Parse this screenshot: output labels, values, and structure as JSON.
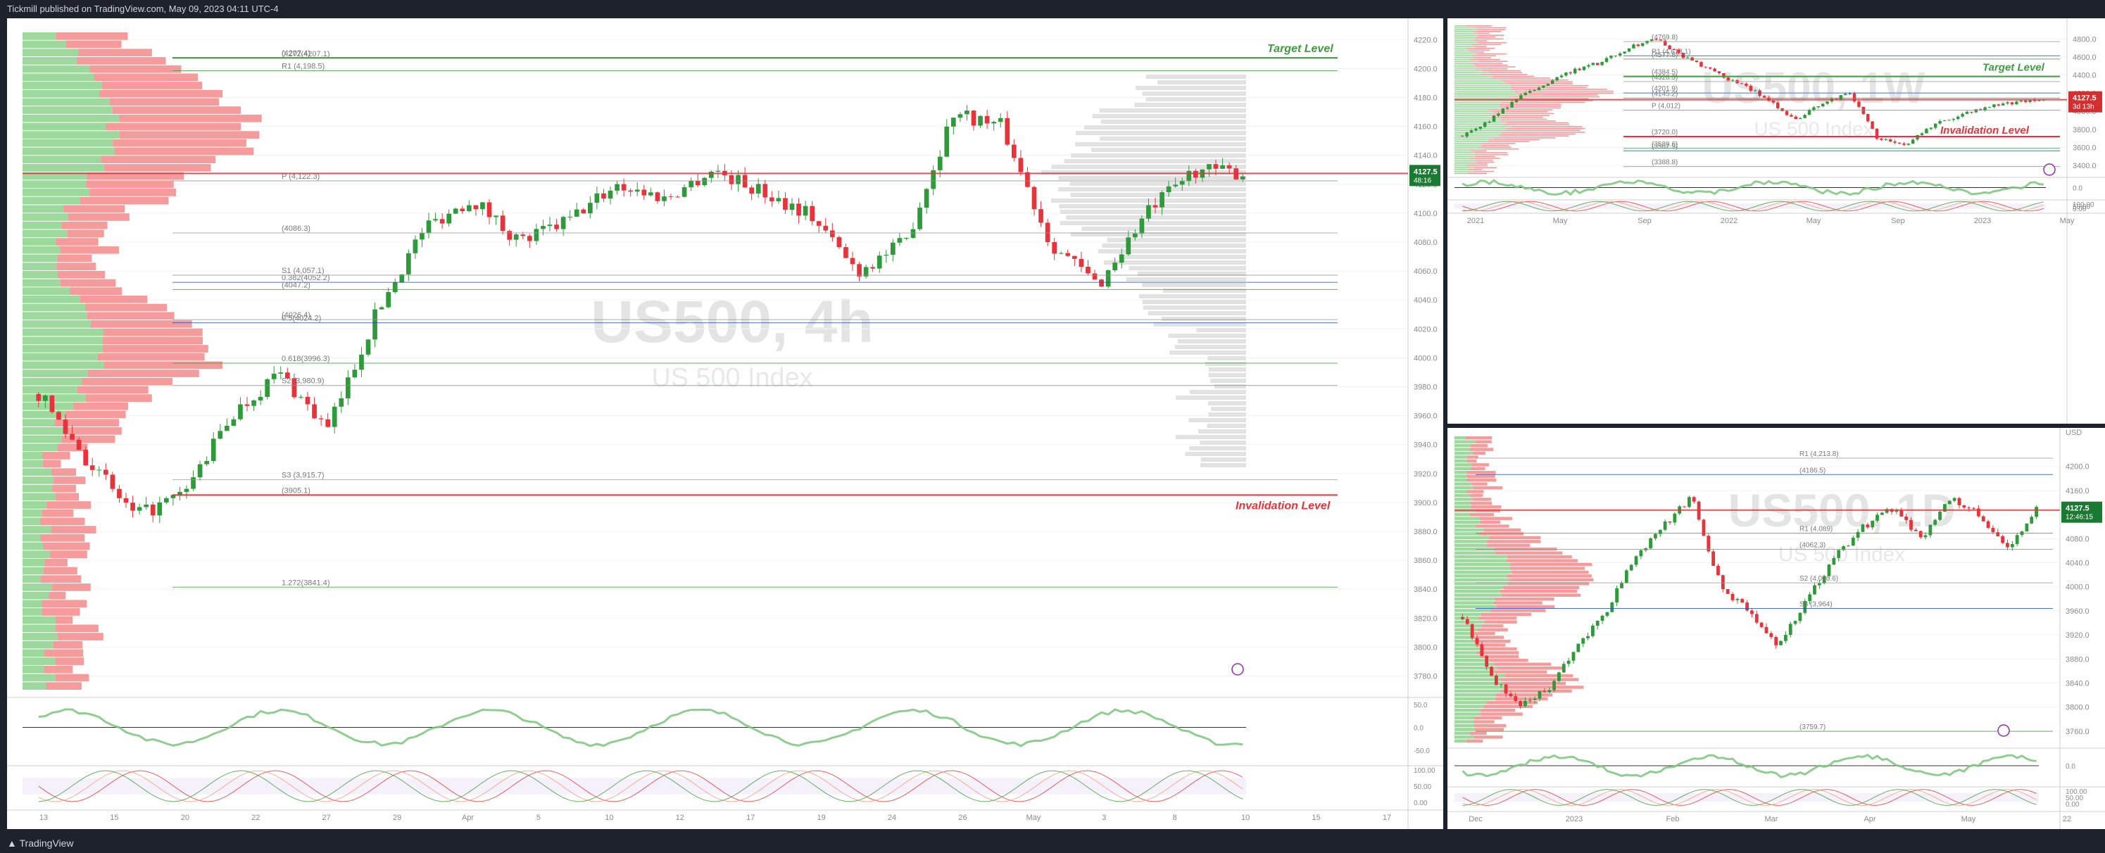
{
  "header": {
    "publisher": "Tickmill published on TradingView.com, May 09, 2023 04:11 UTC-4"
  },
  "footer": {
    "brand": "TradingView"
  },
  "colors": {
    "up": "#2e9a3a",
    "down": "#e8333a",
    "target": "#3f9b3f",
    "invalid": "#e8333a",
    "volume_green": "#7ccc7c",
    "volume_red": "#f27a7a"
  },
  "chart_data": [
    {
      "type": "candlestick",
      "title": "US500, 4h",
      "subtitle": "US 500 Index",
      "ylim": [
        3770,
        4225
      ],
      "y_ticks": [
        "4220.0",
        "4200.0",
        "4180.0",
        "4160.0",
        "4140.0",
        "4120.0",
        "4100.0",
        "4080.0",
        "4060.0",
        "4040.0",
        "4020.0",
        "4000.0",
        "3980.0",
        "3960.0",
        "3940.0",
        "3920.0",
        "3900.0",
        "3880.0",
        "3860.0",
        "3840.0",
        "3820.0",
        "3800.0",
        "3780.0"
      ],
      "x_ticks": [
        "13",
        "15",
        "20",
        "22",
        "27",
        "29",
        "Apr",
        "5",
        "10",
        "12",
        "17",
        "19",
        "24",
        "26",
        "May",
        "3",
        "8",
        "10",
        "15",
        "17"
      ],
      "last_price": "4127.5",
      "countdown": "48:16",
      "target_label": "Target Level",
      "invalidation_label": "Invalidation Level",
      "levels": [
        {
          "label": "(4207.4)",
          "value": 4207.4
        },
        {
          "label": "0.272(4207.1)",
          "value": 4207.1
        },
        {
          "label": "R1 (4,198.5)",
          "value": 4198.5
        },
        {
          "label": "P (4,122.3)",
          "value": 4122.3
        },
        {
          "label": "(4086.3)",
          "value": 4086.3
        },
        {
          "label": "0.382(4052.2)",
          "value": 4052.2
        },
        {
          "label": "(4047.2)",
          "value": 4047.2
        },
        {
          "label": "S1 (4,057.1)",
          "value": 4057.1
        },
        {
          "label": "(4026.4)",
          "value": 4026.4
        },
        {
          "label": "0.5(4024.2)",
          "value": 4024.2
        },
        {
          "label": "0.618(3996.3)",
          "value": 3996.3
        },
        {
          "label": "S2 (3,980.9)",
          "value": 3980.9
        },
        {
          "label": "S3 (3,915.7)",
          "value": 3915.7
        },
        {
          "label": "(3905.1)",
          "value": 3905.1
        },
        {
          "label": "1.272(3841.4)",
          "value": 3841.4
        }
      ],
      "oscillator_ticks": [
        "50.0",
        "0.0",
        "-50.0"
      ],
      "stoch_ticks": [
        "100.00",
        "50.00",
        "0.00"
      ]
    },
    {
      "type": "candlestick",
      "title": "US500, 1W",
      "subtitle": "US 500 Index",
      "ylim": [
        3300,
        4950
      ],
      "y_ticks": [
        "4800.0",
        "4600.0",
        "4400.0",
        "4200.0",
        "4000.0",
        "3800.0",
        "3600.0",
        "3400.0"
      ],
      "x_ticks": [
        "2021",
        "May",
        "Sep",
        "2022",
        "May",
        "Sep",
        "2023",
        "May"
      ],
      "last_price": "4127.5",
      "countdown": "3d 13h",
      "target_label": "Target Level",
      "invalidation_label": "Invalidation Level",
      "levels": [
        {
          "label": "(4769.8)",
          "value": 4769.8
        },
        {
          "label": "R1 (4,613.1)",
          "value": 4613.1
        },
        {
          "label": "(4577.8)",
          "value": 4577.8
        },
        {
          "label": "(4384.5)",
          "value": 4384.5
        },
        {
          "label": "(4328.3)",
          "value": 4328.3
        },
        {
          "label": "(4201.9)",
          "value": 4201.9
        },
        {
          "label": "(4145.2)",
          "value": 4145.2
        },
        {
          "label": "P (4,012)",
          "value": 4012
        },
        {
          "label": "(3720.0)",
          "value": 3720.0
        },
        {
          "label": "(3562.9)",
          "value": 3562.9
        },
        {
          "label": "(3589.6)",
          "value": 3589.6
        },
        {
          "label": "(3388.8)",
          "value": 3388.8
        }
      ],
      "oscillator_ticks": [
        "0.0"
      ],
      "stoch_ticks": [
        "100.00",
        "50.00",
        "0.00"
      ]
    },
    {
      "type": "candlestick",
      "title": "US500, 1D",
      "subtitle": "US 500 Index",
      "ylim": [
        3740,
        4250
      ],
      "y_ticks": [
        "USD",
        "4200.0",
        "4160.0",
        "4120.0",
        "4080.0",
        "4040.0",
        "4000.0",
        "3960.0",
        "3920.0",
        "3880.0",
        "3840.0",
        "3800.0",
        "3760.0"
      ],
      "x_ticks": [
        "Dec",
        "2023",
        "Feb",
        "Mar",
        "Apr",
        "May",
        "22"
      ],
      "last_price": "4127.5",
      "countdown": "12:46:15",
      "levels": [
        {
          "label": "R1 (4,213.8)",
          "value": 4213.8
        },
        {
          "label": "(4186.5)",
          "value": 4186.5
        },
        {
          "label": "R1 (4,089)",
          "value": 4089
        },
        {
          "label": "(4062.3)",
          "value": 4062.3
        },
        {
          "label": "S2 (4,006.6)",
          "value": 4006.6
        },
        {
          "label": "S3 (3,964)",
          "value": 3964
        },
        {
          "label": "(3759.7)",
          "value": 3759.7
        }
      ],
      "oscillator_ticks": [
        "0.0"
      ],
      "stoch_ticks": [
        "100.00",
        "50.00",
        "0.00"
      ]
    }
  ]
}
